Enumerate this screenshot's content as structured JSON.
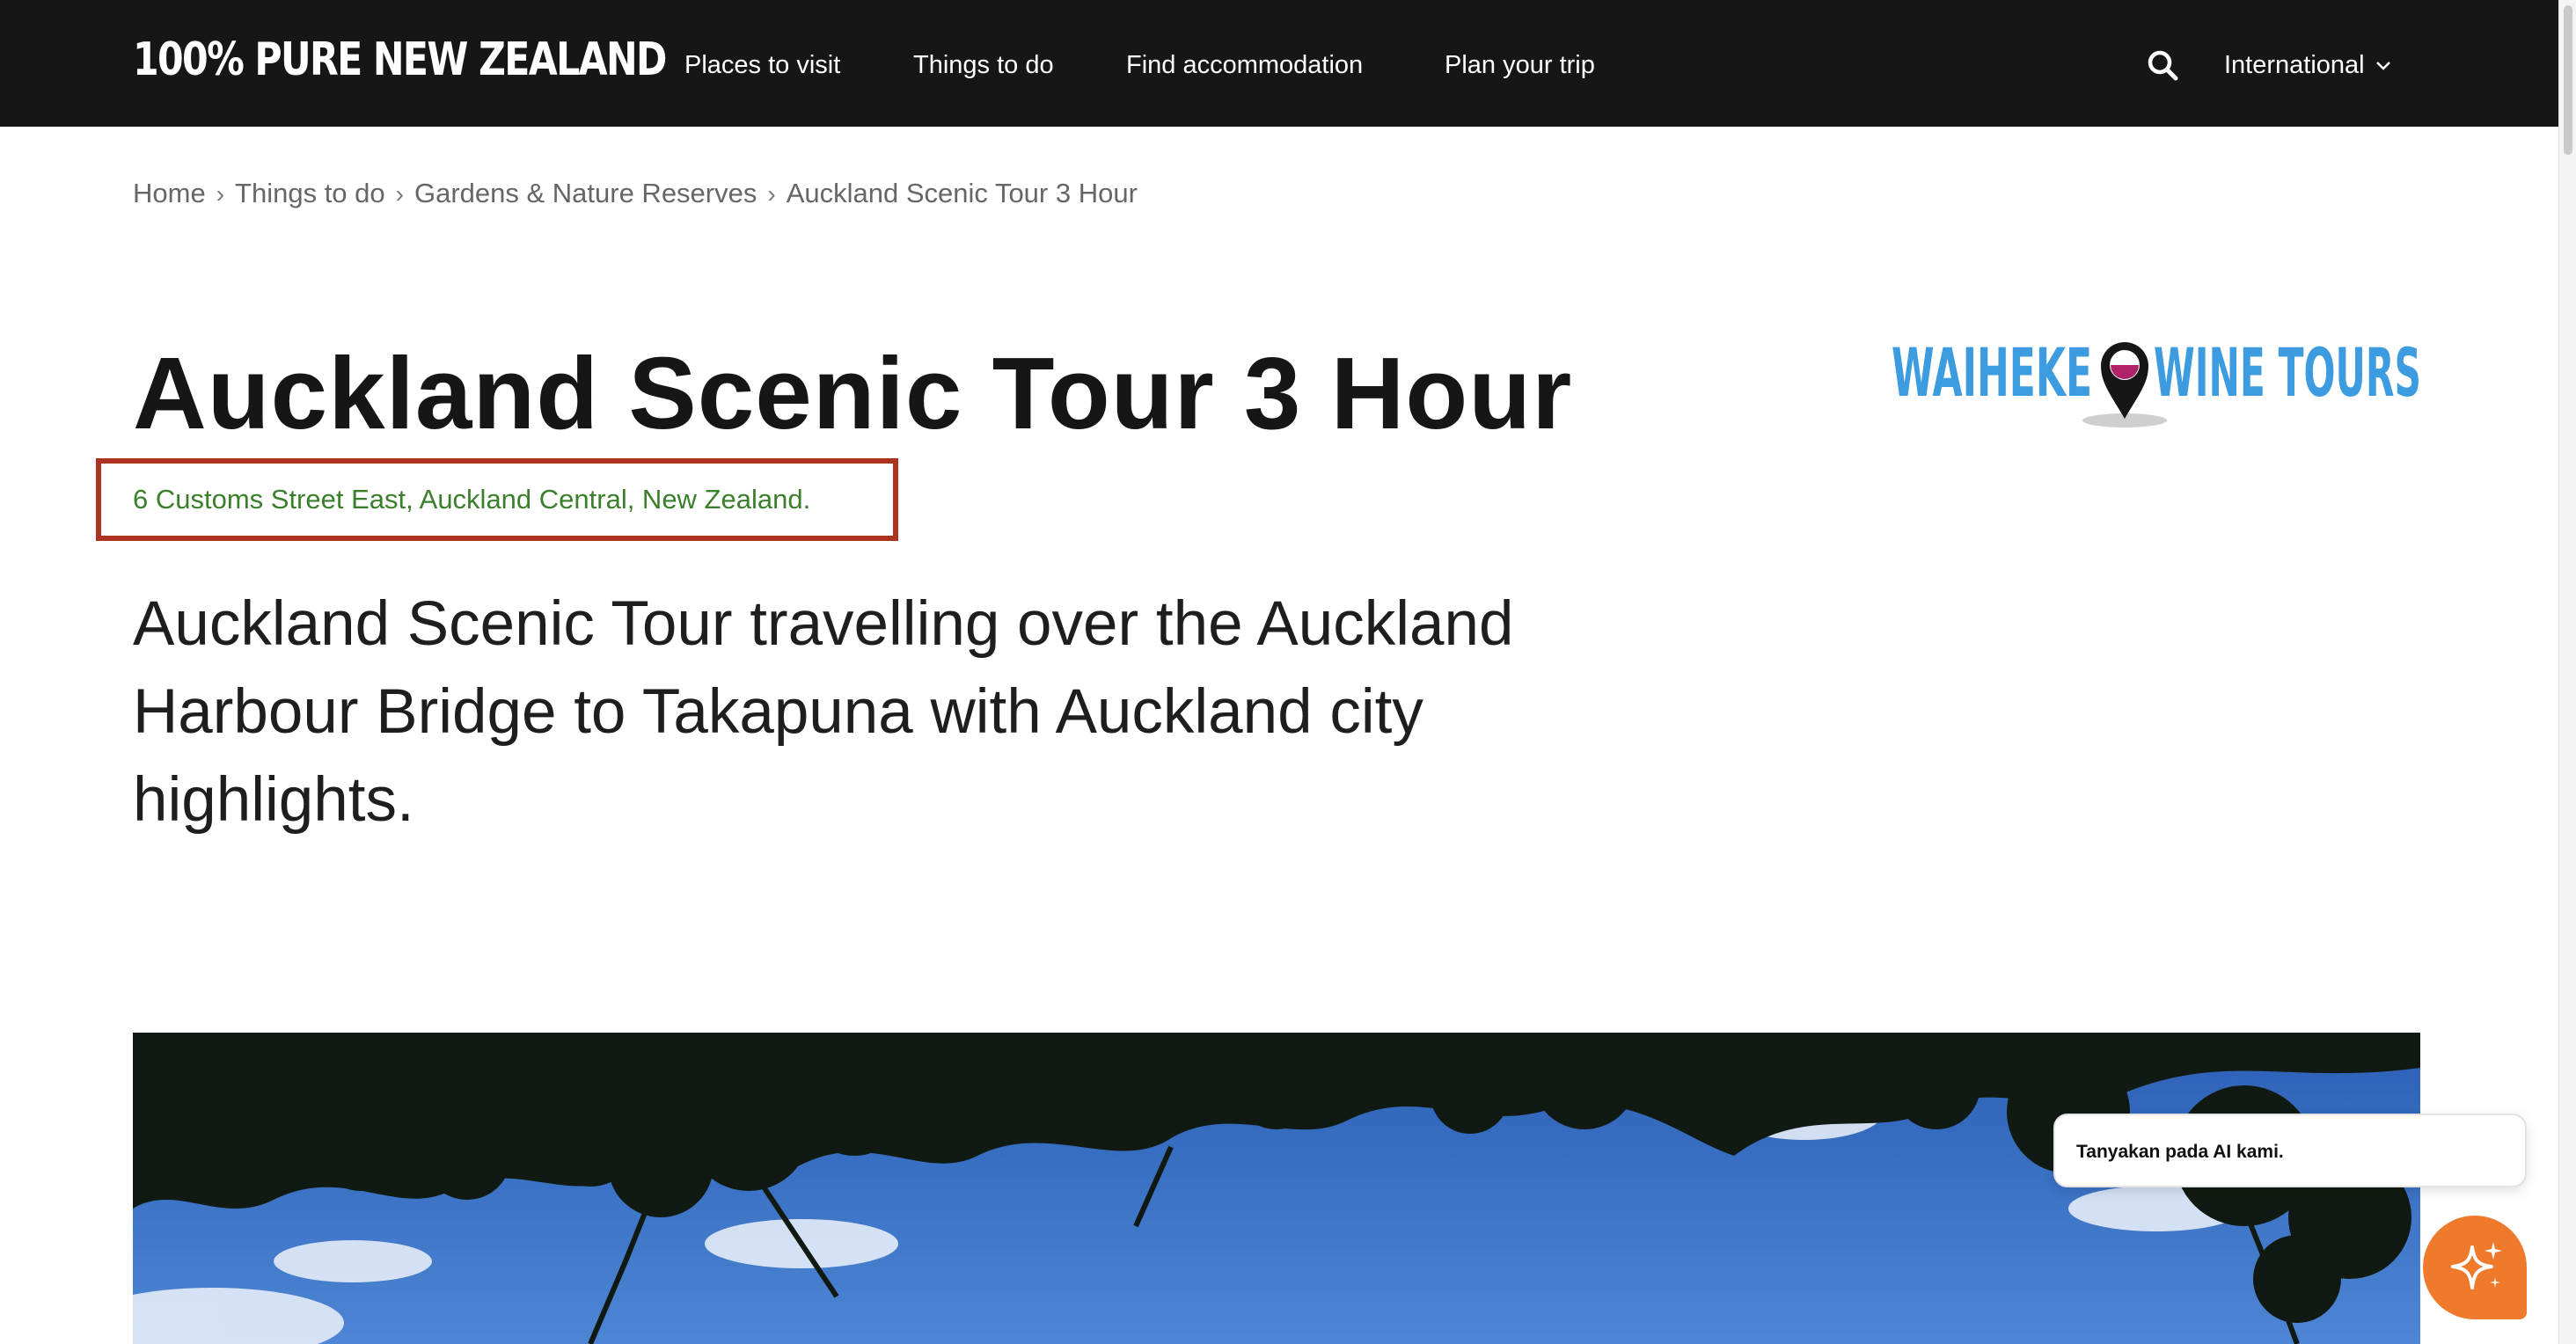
{
  "nav": {
    "logo_text": "100% PURE NEW ZEALAND",
    "items": [
      {
        "label": "Places to visit"
      },
      {
        "label": "Things to do"
      },
      {
        "label": "Find accommodation"
      },
      {
        "label": "Plan your trip"
      }
    ],
    "search_icon": "search-icon",
    "region_label": "International",
    "region_icon": "chevron-down-icon"
  },
  "breadcrumb": {
    "items": [
      "Home",
      "Things to do",
      "Gardens & Nature Reserves",
      "Auckland Scenic Tour 3 Hour"
    ],
    "separator": "›"
  },
  "listing": {
    "title": "Auckland Scenic Tour 3 Hour",
    "address": "6 Customs Street East, Auckland Central, New Zealand.",
    "description": "Auckland Scenic Tour travelling over the Auckland Harbour Bridge to Takapuna with Auckland city highlights.",
    "operator_logo": {
      "left_text": "WAIHEKE",
      "right_text": "WINE TOURS",
      "color": "#3d9be0",
      "pin_color": "#b0226a"
    }
  },
  "highlight_color": "#ad3321",
  "address_color": "#3a7f2b",
  "chat": {
    "prompt": "Tanyakan pada AI kami.",
    "button_icon": "sparkle-icon",
    "button_color": "#ef7a2c"
  }
}
